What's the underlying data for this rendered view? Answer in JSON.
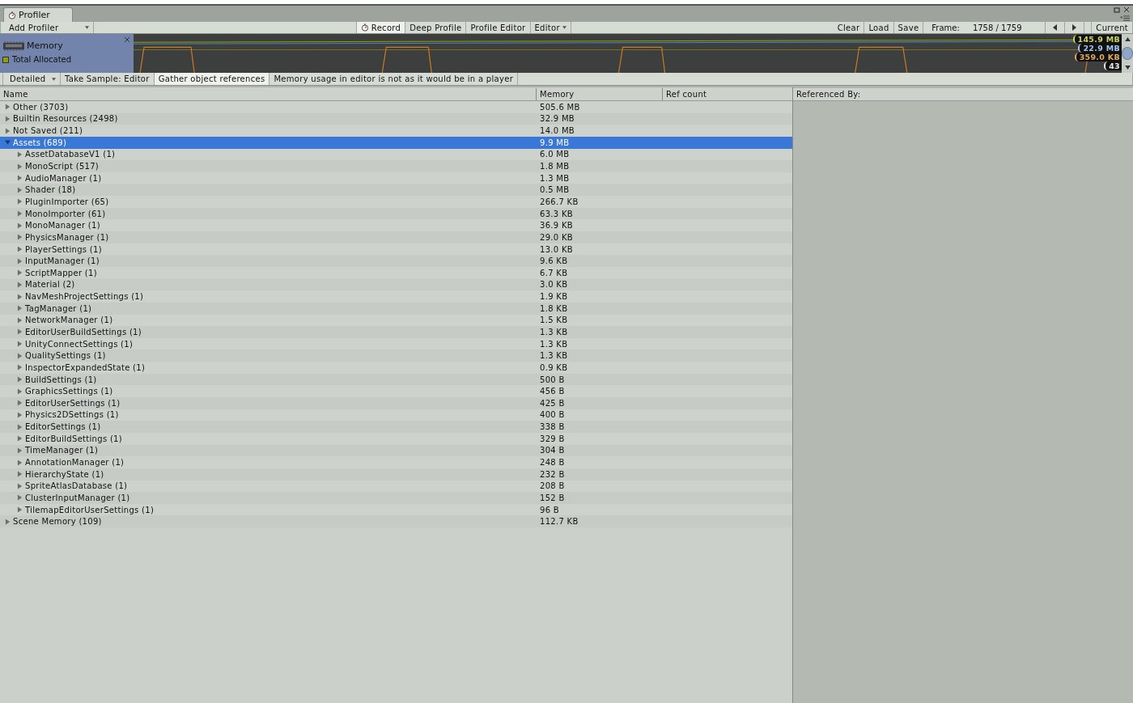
{
  "window": {
    "tab": "Profiler"
  },
  "toolbar": {
    "add_profiler": "Add Profiler",
    "record": {
      "label": "Record",
      "on": true
    },
    "deep_profile": {
      "label": "Deep Profile",
      "on": false
    },
    "profile_editor": {
      "label": "Profile Editor",
      "on": false
    },
    "target": "Editor",
    "clear": "Clear",
    "load": "Load",
    "save": "Save",
    "frame_label": "Frame:",
    "frame": "1758 / 1759",
    "current": "Current"
  },
  "module": {
    "title": "Memory",
    "legend": [
      {
        "label": "Total Allocated",
        "color": "#8fa000"
      }
    ],
    "readings": [
      {
        "text": "145.9 MB",
        "color": "#c9d36a"
      },
      {
        "text": "22.9 MB",
        "color": "#9fc4e8"
      },
      {
        "text": "359.0 KB",
        "color": "#e0a65a"
      },
      {
        "text": "43",
        "color": "#e8e8e8"
      }
    ]
  },
  "memory_toolbar": {
    "view": "Detailed",
    "take_sample": "Take Sample: Editor",
    "gather": {
      "label": "Gather object references",
      "on": true
    },
    "note": "Memory usage in editor is not as it would be in a player"
  },
  "table": {
    "columns": [
      "Name",
      "Memory",
      "Ref count"
    ],
    "rows": [
      {
        "name": "Other (3703)",
        "memory": "505.6 MB",
        "expanded": false,
        "selected": false
      },
      {
        "name": "Builtin Resources (2498)",
        "memory": "32.9 MB",
        "expanded": false,
        "selected": false
      },
      {
        "name": "Not Saved (211)",
        "memory": "14.0 MB",
        "expanded": false,
        "selected": false
      },
      {
        "name": "Assets (689)",
        "memory": "9.9 MB",
        "expanded": true,
        "selected": true,
        "children": [
          {
            "name": "AssetDatabaseV1 (1)",
            "memory": "6.0 MB",
            "expanded": false,
            "selected": false
          },
          {
            "name": "MonoScript (517)",
            "memory": "1.8 MB",
            "expanded": false,
            "selected": false
          },
          {
            "name": "AudioManager (1)",
            "memory": "1.3 MB",
            "expanded": false,
            "selected": false
          },
          {
            "name": "Shader (18)",
            "memory": "0.5 MB",
            "expanded": false,
            "selected": false
          },
          {
            "name": "PluginImporter (65)",
            "memory": "266.7 KB",
            "expanded": false,
            "selected": false
          },
          {
            "name": "MonoImporter (61)",
            "memory": "63.3 KB",
            "expanded": false,
            "selected": false
          },
          {
            "name": "MonoManager (1)",
            "memory": "36.9 KB",
            "expanded": false,
            "selected": false
          },
          {
            "name": "PhysicsManager (1)",
            "memory": "29.0 KB",
            "expanded": false,
            "selected": false
          },
          {
            "name": "PlayerSettings (1)",
            "memory": "13.0 KB",
            "expanded": false,
            "selected": false
          },
          {
            "name": "InputManager (1)",
            "memory": "9.6 KB",
            "expanded": false,
            "selected": false
          },
          {
            "name": "ScriptMapper (1)",
            "memory": "6.7 KB",
            "expanded": false,
            "selected": false
          },
          {
            "name": "Material (2)",
            "memory": "3.0 KB",
            "expanded": false,
            "selected": false
          },
          {
            "name": "NavMeshProjectSettings (1)",
            "memory": "1.9 KB",
            "expanded": false,
            "selected": false
          },
          {
            "name": "TagManager (1)",
            "memory": "1.8 KB",
            "expanded": false,
            "selected": false
          },
          {
            "name": "NetworkManager (1)",
            "memory": "1.5 KB",
            "expanded": false,
            "selected": false
          },
          {
            "name": "EditorUserBuildSettings (1)",
            "memory": "1.3 KB",
            "expanded": false,
            "selected": false
          },
          {
            "name": "UnityConnectSettings (1)",
            "memory": "1.3 KB",
            "expanded": false,
            "selected": false
          },
          {
            "name": "QualitySettings (1)",
            "memory": "1.3 KB",
            "expanded": false,
            "selected": false
          },
          {
            "name": "InspectorExpandedState (1)",
            "memory": "0.9 KB",
            "expanded": false,
            "selected": false
          },
          {
            "name": "BuildSettings (1)",
            "memory": "500 B",
            "expanded": false,
            "selected": false
          },
          {
            "name": "GraphicsSettings (1)",
            "memory": "456 B",
            "expanded": false,
            "selected": false
          },
          {
            "name": "EditorUserSettings (1)",
            "memory": "425 B",
            "expanded": false,
            "selected": false
          },
          {
            "name": "Physics2DSettings (1)",
            "memory": "400 B",
            "expanded": false,
            "selected": false
          },
          {
            "name": "EditorSettings (1)",
            "memory": "338 B",
            "expanded": false,
            "selected": false
          },
          {
            "name": "EditorBuildSettings (1)",
            "memory": "329 B",
            "expanded": false,
            "selected": false
          },
          {
            "name": "TimeManager (1)",
            "memory": "304 B",
            "expanded": false,
            "selected": false
          },
          {
            "name": "AnnotationManager (1)",
            "memory": "248 B",
            "expanded": false,
            "selected": false
          },
          {
            "name": "HierarchyState (1)",
            "memory": "232 B",
            "expanded": false,
            "selected": false
          },
          {
            "name": "SpriteAtlasDatabase (1)",
            "memory": "208 B",
            "expanded": false,
            "selected": false
          },
          {
            "name": "ClusterInputManager (1)",
            "memory": "152 B",
            "expanded": false,
            "selected": false
          },
          {
            "name": "TilemapEditorUserSettings (1)",
            "memory": "96 B",
            "expanded": false,
            "selected": false
          }
        ]
      },
      {
        "name": "Scene Memory (109)",
        "memory": "112.7 KB",
        "expanded": false,
        "selected": false
      }
    ]
  },
  "referenced_by": {
    "title": "Referenced By:"
  }
}
